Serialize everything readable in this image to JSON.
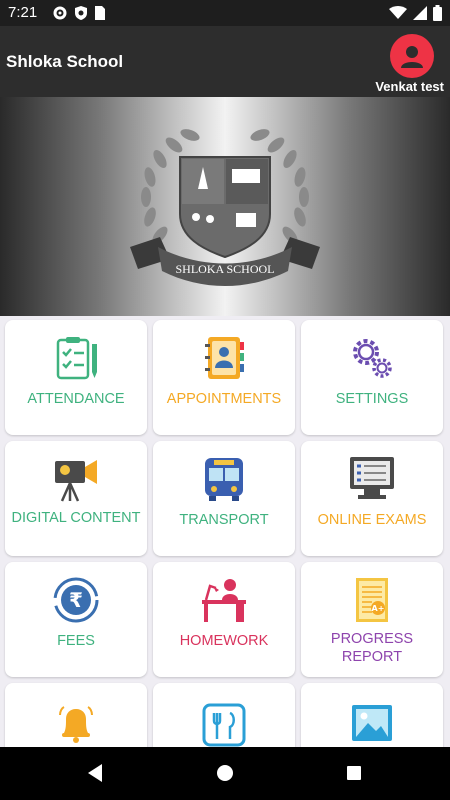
{
  "status_bar": {
    "time": "7:21",
    "left_icons": [
      "gear-icon",
      "shield-icon",
      "sim-icon"
    ],
    "right_icons": [
      "wifi-icon",
      "signal-icon",
      "battery-icon"
    ]
  },
  "app_bar": {
    "title": "Shloka School",
    "user_name": "Venkat test",
    "avatar_color": "#ee3345"
  },
  "banner": {
    "logo_text": "SHLOKA SCHOOL"
  },
  "menu": [
    {
      "label": "ATTENDANCE",
      "color": "#3fb27f",
      "icon": "clipboard-checklist-icon"
    },
    {
      "label": "APPOINTMENTS",
      "color": "#f4a925",
      "icon": "contact-book-icon"
    },
    {
      "label": "SETTINGS",
      "color": "#3fb27f",
      "icon": "gears-icon"
    },
    {
      "label": "DIGITAL CONTENT",
      "color": "#3fb27f",
      "icon": "video-camera-icon"
    },
    {
      "label": "TRANSPORT",
      "color": "#3fb27f",
      "icon": "bus-icon"
    },
    {
      "label": "ONLINE EXAMS",
      "color": "#f4a925",
      "icon": "computer-exam-icon"
    },
    {
      "label": "FEES",
      "color": "#3fb27f",
      "icon": "rupee-icon"
    },
    {
      "label": "HOMEWORK",
      "color": "#d9335d",
      "icon": "study-desk-icon"
    },
    {
      "label": "PROGRESS REPORT",
      "color": "#8e44ad",
      "icon": "report-card-icon"
    },
    {
      "label": "",
      "color": "#f4a925",
      "icon": "bell-icon"
    },
    {
      "label": "",
      "color": "#2a9fd6",
      "icon": "fork-knife-icon"
    },
    {
      "label": "",
      "color": "#2a9fd6",
      "icon": "gallery-image-icon"
    }
  ],
  "nav_bar": [
    "back-icon",
    "home-icon",
    "recents-icon"
  ]
}
